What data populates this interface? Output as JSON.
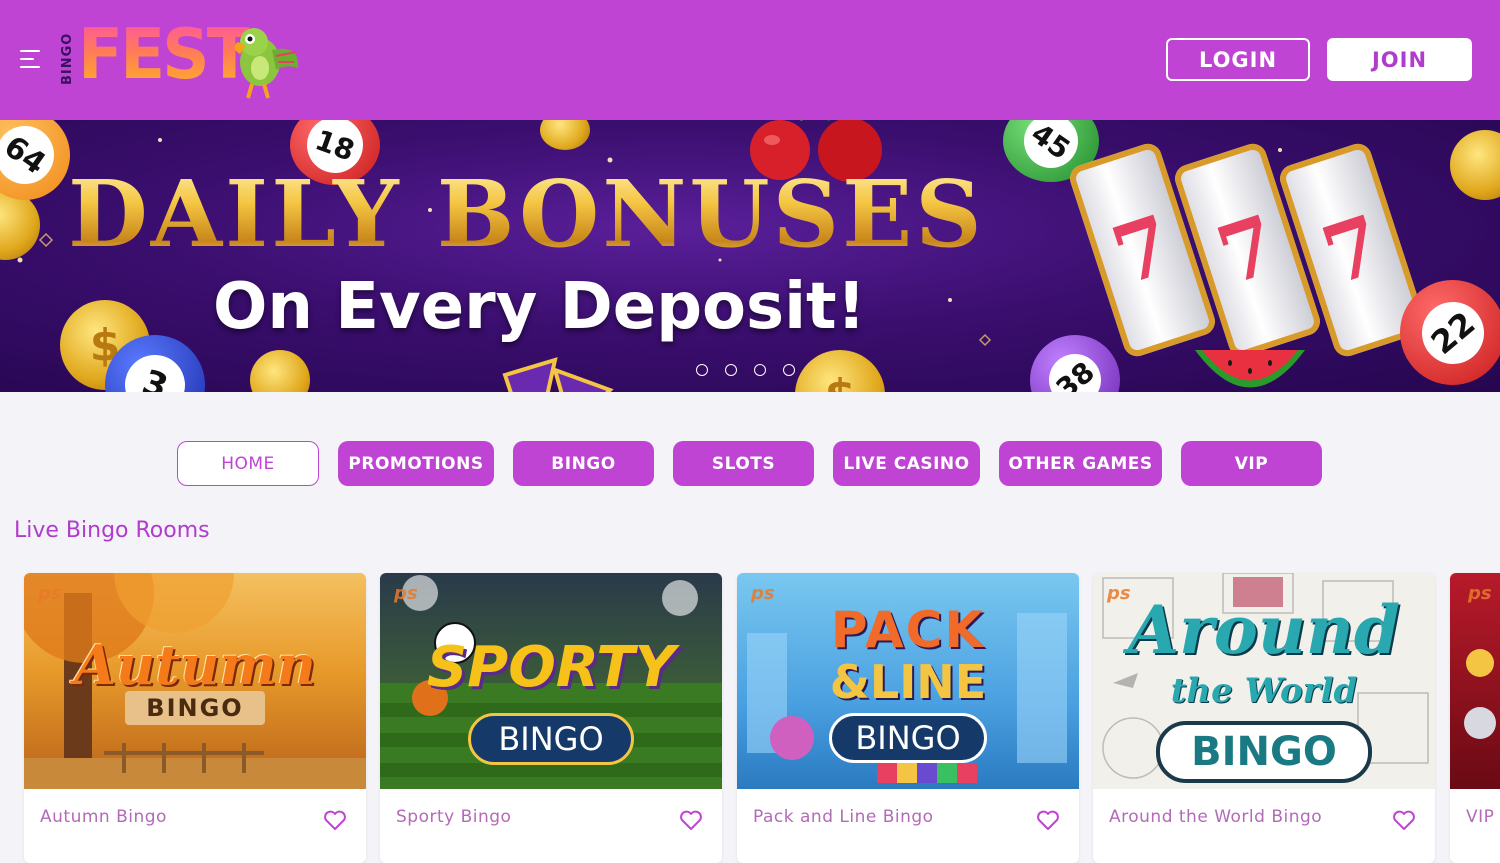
{
  "header": {
    "logo_vertical": "BINGO",
    "logo_main": "FEST",
    "login_label": "LOGIN",
    "join_label": "JOIN"
  },
  "banner": {
    "title": "DAILY BONUSES",
    "subtitle": "On Every Deposit!",
    "balls": [
      "64",
      "18",
      "45",
      "3",
      "38",
      "22"
    ],
    "reel_symbol": "7",
    "slide_count": 4
  },
  "nav": {
    "items": [
      {
        "label": "HOME",
        "active": true
      },
      {
        "label": "PROMOTIONS",
        "active": false
      },
      {
        "label": "BINGO",
        "active": false
      },
      {
        "label": "SLOTS",
        "active": false
      },
      {
        "label": "LIVE CASINO",
        "active": false
      },
      {
        "label": "OTHER GAMES",
        "active": false
      },
      {
        "label": "VIP",
        "active": false
      }
    ]
  },
  "section": {
    "title": "Live Bingo Rooms"
  },
  "cards": [
    {
      "name": "Autumn Bingo",
      "art_title": "Autumn",
      "art_sub": "BINGO",
      "provider": "ps"
    },
    {
      "name": "Sporty Bingo",
      "art_title": "SPORTY",
      "art_sub": "BINGO",
      "provider": "ps"
    },
    {
      "name": "Pack and Line Bingo",
      "art_title": "PACK",
      "art_title2": "&LINE",
      "art_sub": "BINGO",
      "provider": "ps"
    },
    {
      "name": "Around the World Bingo",
      "art_title": "Around",
      "art_title2": "the World",
      "art_sub": "BINGO",
      "provider": "ps"
    },
    {
      "name": "VIP",
      "provider": "ps"
    }
  ],
  "colors": {
    "brand": "#c044d4",
    "card_text": "#b36ab8",
    "background": "#f4f4f8"
  }
}
